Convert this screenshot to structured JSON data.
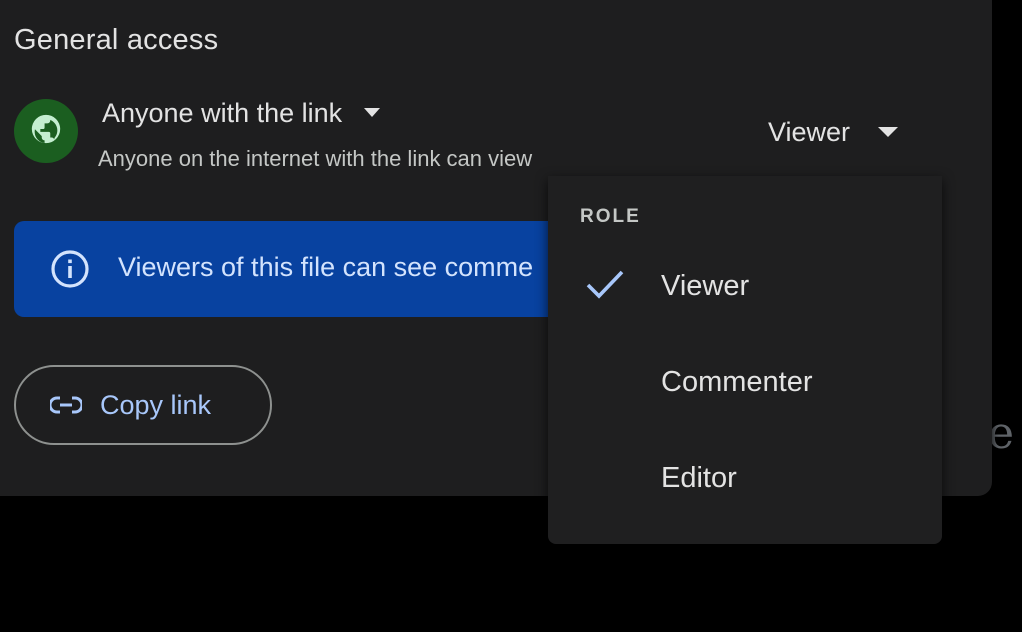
{
  "general_access": {
    "title": "General access",
    "access_option": "Anyone with the link",
    "access_description": "Anyone on the internet with the link can view",
    "role_selected": "Viewer"
  },
  "info_banner": {
    "text": "Viewers of this file can see comme"
  },
  "copy_link": {
    "label": "Copy link"
  },
  "role_menu": {
    "header": "ROLE",
    "items": [
      {
        "label": "Viewer",
        "checked": true
      },
      {
        "label": "Commenter",
        "checked": false
      },
      {
        "label": "Editor",
        "checked": false
      }
    ]
  },
  "backdrop": {
    "letter": "e"
  },
  "colors": {
    "panel": "#1e1e1f",
    "globe_badge": "#1b5e20",
    "info_banner": "#0842a0",
    "link_accent": "#a8c7fa",
    "check_accent": "#a8c7fa"
  },
  "icons": [
    "globe-icon",
    "dropdown-caret-icon",
    "info-icon",
    "link-icon",
    "checkmark-icon"
  ]
}
